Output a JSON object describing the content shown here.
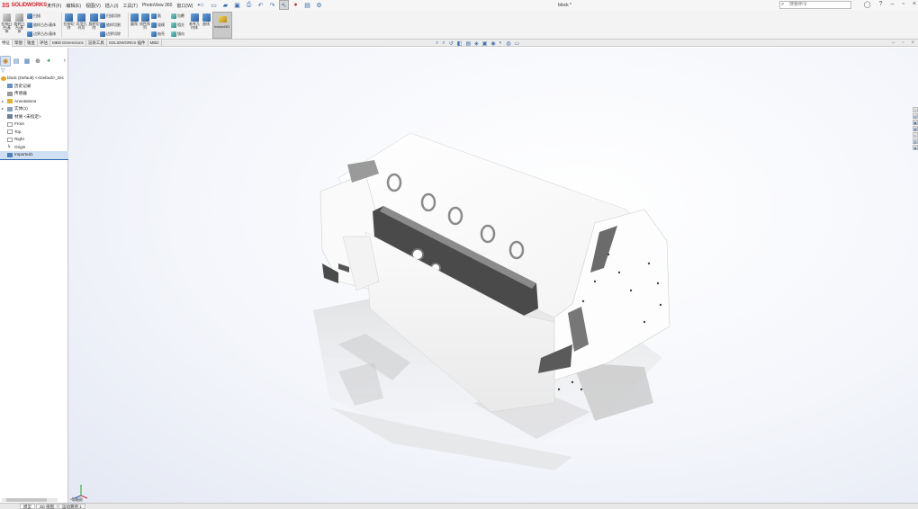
{
  "app": {
    "brand_ds": "3S",
    "brand_name": "SOLIDWORKS",
    "document_title": "block *",
    "search_placeholder": "搜索命令"
  },
  "menu": [
    "文件(F)",
    "编辑(E)",
    "视图(V)",
    "插入(I)",
    "工具(T)",
    "PhotoView 360",
    "窗口(W)"
  ],
  "ribbon": {
    "extruded_boss": "拉伸凸台/基体",
    "revolved_boss": "旋转凸台/基体",
    "swept_boss": "扫描",
    "lofted_boss": "放样凸台/基体",
    "boundary_boss": "边界凸台/基体",
    "extruded_cut": "拉伸切除",
    "hole_wizard": "异型孔向导",
    "revolved_cut": "旋转切除",
    "swept_cut": "扫描切除",
    "lofted_cut": "放样切割",
    "boundary_cut": "边界切除",
    "fillet": "圆角",
    "linear_pattern": "线性阵列",
    "rib": "筋",
    "draft": "拔模",
    "shell": "抽壳",
    "wrap": "包覆",
    "intersect": "相交",
    "mirror": "镜向",
    "reference_geometry": "参考几何体",
    "curves": "曲线",
    "instant3d": "Instant3D"
  },
  "tabs": [
    "特征",
    "草图",
    "钣金",
    "评估",
    "MBD Dimensions",
    "渲染工具",
    "SOLIDWORKS 插件",
    "MBD"
  ],
  "tree": {
    "root": "block (Default) <<Default>_Dis",
    "items": [
      "历史记录",
      "传感器",
      "Annotations",
      "实体(1)",
      "材质 <未指定>",
      "Front",
      "Top",
      "Right",
      "Origin",
      "Imported1"
    ]
  },
  "graphics": {
    "triad_label": "*等轴测"
  },
  "bottom_tabs": [
    "模型",
    "3D 视图",
    "运动算例 1"
  ]
}
